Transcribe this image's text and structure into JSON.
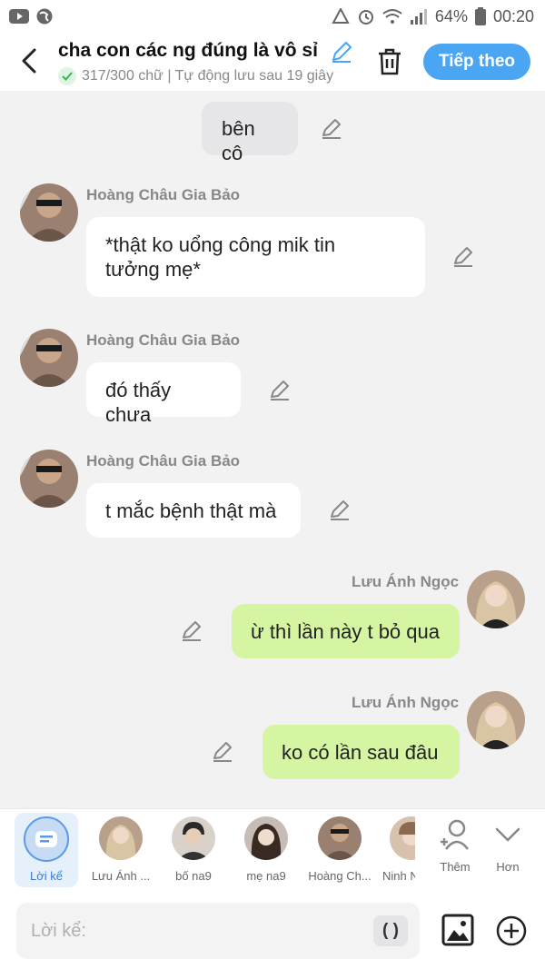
{
  "status_bar": {
    "battery": "64%",
    "time": "00:20",
    "icons_left": [
      "youtube-icon",
      "globe-icon"
    ],
    "icons_right": [
      "recycle-icon",
      "alarm-icon",
      "wifi-icon",
      "signal-icon",
      "battery-icon"
    ]
  },
  "header": {
    "title": "cha con các ng đúng là vô sỉ",
    "subtitle": "317/300 chữ | Tự động lưu sau 19 giây",
    "next_label": "Tiếp theo"
  },
  "messages": [
    {
      "kind": "narration",
      "text": "bên cô"
    },
    {
      "kind": "left",
      "sender": "Hoàng Châu Gia Bảo",
      "line1": "*thật ko uổng công mik tin",
      "line2": "tưởng mẹ*"
    },
    {
      "kind": "left",
      "sender": "Hoàng Châu Gia Bảo",
      "text": "đó thấy chưa"
    },
    {
      "kind": "left",
      "sender": "Hoàng Châu Gia Bảo",
      "text": "t mắc bệnh thật mà"
    },
    {
      "kind": "right",
      "sender": "Lưu Ánh Ngọc",
      "text": "ừ thì lần này t bỏ qua"
    },
    {
      "kind": "right",
      "sender": "Lưu Ánh Ngọc",
      "text": "ko có lần sau đâu"
    }
  ],
  "characters": {
    "narrator_label": "Lời kể",
    "items": [
      "Lưu Ánh ...",
      "bố na9",
      "mẹ na9",
      "Hoàng Ch...",
      "Ninh N"
    ],
    "add_label": "Thêm",
    "more_label": "Hơn"
  },
  "input": {
    "placeholder": "Lời kể:",
    "paren_label": "( )"
  },
  "colors": {
    "accent": "#4aa5f3",
    "my_bubble": "#d5f5a2",
    "background": "#f2f2f3"
  }
}
